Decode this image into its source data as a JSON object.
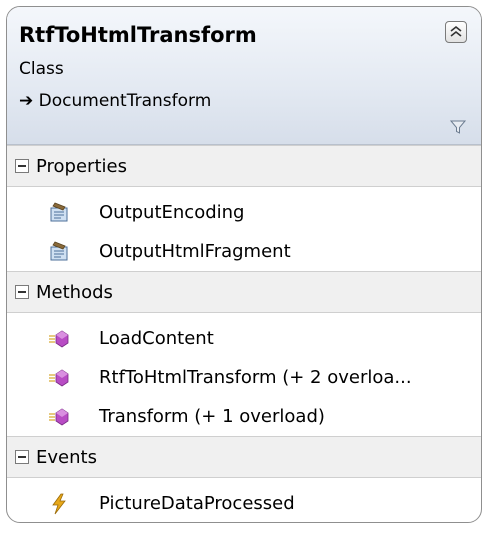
{
  "class": {
    "name": "RtfToHtmlTransform",
    "kind": "Class",
    "base": "➔ DocumentTransform"
  },
  "sections": [
    {
      "title": "Properties",
      "members": [
        {
          "label": "OutputEncoding",
          "icon": "property-icon"
        },
        {
          "label": "OutputHtmlFragment",
          "icon": "property-icon"
        }
      ]
    },
    {
      "title": "Methods",
      "members": [
        {
          "label": "LoadContent",
          "icon": "method-icon"
        },
        {
          "label": "RtfToHtmlTransform (+ 2 overloa...",
          "icon": "method-icon"
        },
        {
          "label": "Transform (+ 1 overload)",
          "icon": "method-icon"
        }
      ]
    },
    {
      "title": "Events",
      "members": [
        {
          "label": "PictureDataProcessed",
          "icon": "event-icon"
        }
      ]
    }
  ],
  "colors": {
    "header_top": "#f4f7fb",
    "header_bottom": "#d6deea",
    "method_icon": "#b84cc4",
    "property_icon": "#6a8fbf",
    "event_icon": "#e7a81a"
  }
}
